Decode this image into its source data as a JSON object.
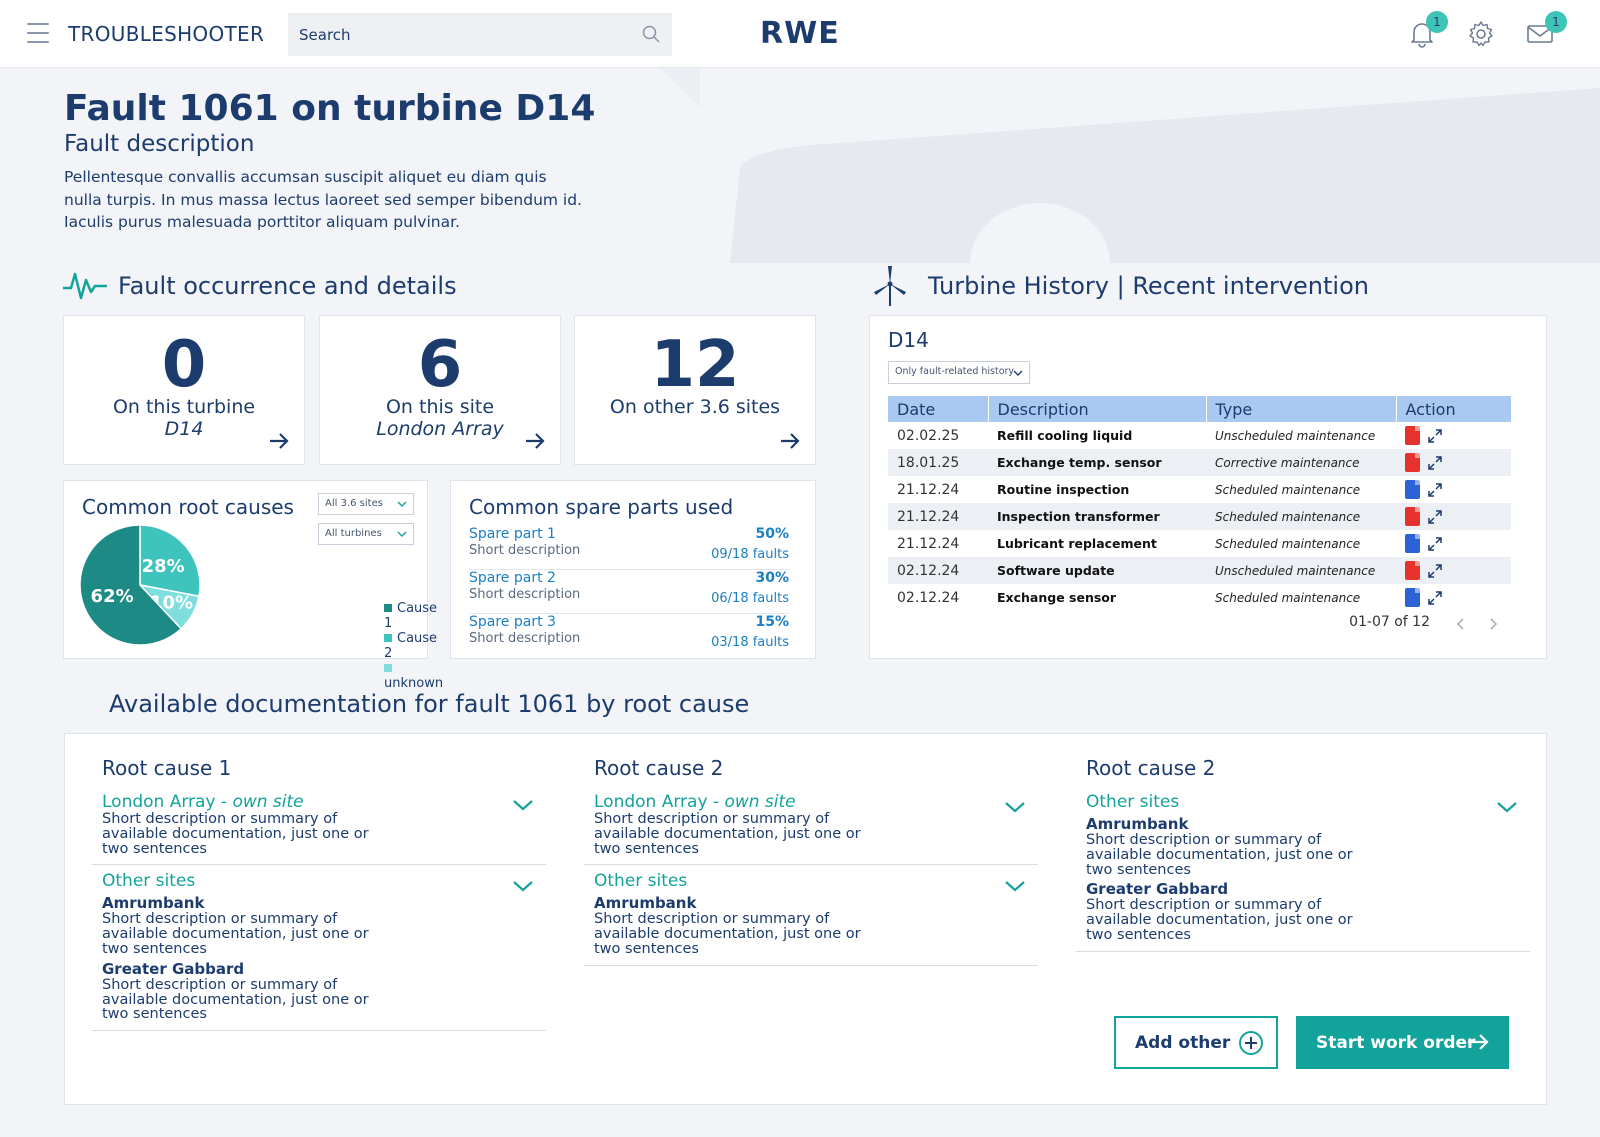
{
  "header": {
    "app_title": "TROUBLESHOOTER",
    "search_placeholder": "Search",
    "logo": "RWE",
    "notifications_count": "1",
    "messages_count": "1"
  },
  "hero": {
    "title": "Fault 1061 on turbine D14",
    "subtitle": "Fault description",
    "description": "Pellentesque convallis accumsan suscipit aliquet eu diam quis nulla turpis. In mus massa lectus laoreet sed semper bibendum id. Iaculis purus malesuada porttitor aliquam pulvinar."
  },
  "fault_section": {
    "title": "Fault occurrence and details",
    "kpis": [
      {
        "value": "0",
        "label": "On this turbine",
        "sub": "D14"
      },
      {
        "value": "6",
        "label": "On this site",
        "sub": "London Array"
      },
      {
        "value": "12",
        "label": "On other 3.6 sites",
        "sub": ""
      }
    ]
  },
  "root_causes": {
    "title": "Common root causes",
    "filter_sites": "All 3.6 sites",
    "filter_turbines": "All turbines",
    "legend": [
      "Cause 1",
      "Cause 2",
      "unknown"
    ],
    "colors": [
      "#1e8a86",
      "#3ec4bc",
      "#7fdedd"
    ]
  },
  "chart_data": {
    "type": "pie",
    "labels": [
      "Cause 1",
      "Cause 2",
      "unknown"
    ],
    "values": [
      62,
      28,
      10
    ],
    "data_labels": [
      "62%",
      "28%",
      "10%"
    ]
  },
  "spare_parts": {
    "title": "Common spare parts used",
    "items": [
      {
        "name": "Spare part 1",
        "desc": "Short description",
        "pct": "50%",
        "faults": "09/18 faults"
      },
      {
        "name": "Spare part 2",
        "desc": "Short description",
        "pct": "30%",
        "faults": "06/18 faults"
      },
      {
        "name": "Spare part 3",
        "desc": "Short description",
        "pct": "15%",
        "faults": "03/18 faults"
      }
    ]
  },
  "history": {
    "title": "Turbine History | Recent intervention",
    "turbine": "D14",
    "filter": "Only fault-related history",
    "columns": [
      "Date",
      "Description",
      "Type",
      "Action"
    ],
    "rows": [
      {
        "date": "02.02.25",
        "desc": "Refill cooling liquid",
        "type": "Unscheduled maintenance",
        "file": "pdf"
      },
      {
        "date": "18.01.25",
        "desc": "Exchange temp. sensor",
        "type": "Corrective maintenance",
        "file": "pdf"
      },
      {
        "date": "21.12.24",
        "desc": "Routine inspection",
        "type": "Scheduled maintenance",
        "file": "doc"
      },
      {
        "date": "21.12.24",
        "desc": "Inspection transformer",
        "type": "Scheduled maintenance",
        "file": "pdf"
      },
      {
        "date": "21.12.24",
        "desc": "Lubricant replacement",
        "type": "Scheduled maintenance",
        "file": "doc"
      },
      {
        "date": "02.12.24",
        "desc": "Software update",
        "type": "Unscheduled maintenance",
        "file": "pdf"
      },
      {
        "date": "02.12.24",
        "desc": "Exchange sensor",
        "type": "Scheduled maintenance",
        "file": "doc"
      }
    ],
    "pagination": "01-07 of 12"
  },
  "docs": {
    "title": "Available documentation for fault 1061 by root cause",
    "columns": [
      {
        "heading": "Root cause 1",
        "own_site": "London Array -",
        "own_site_tag": "own site",
        "own_text": "Short description or summary of available documentation, just one or two sentences",
        "other_label": "Other sites",
        "other_sites": [
          {
            "name": "Amrumbank",
            "text": "Short description or summary of available documentation, just one or two sentences"
          },
          {
            "name": "Greater Gabbard",
            "text": "Short description or summary of available documentation, just one or two sentences"
          }
        ]
      },
      {
        "heading": "Root cause 2",
        "own_site": "London Array -",
        "own_site_tag": "own site",
        "own_text": "Short description or summary of available documentation, just one or two sentences",
        "other_label": "Other sites",
        "other_sites": [
          {
            "name": "Amrumbank",
            "text": "Short description or summary of available documentation, just one or two sentences"
          }
        ]
      },
      {
        "heading": "Root cause 2",
        "other_label": "Other sites",
        "other_sites": [
          {
            "name": "Amrumbank",
            "text": "Short description or summary of available documentation, just one or two sentences"
          },
          {
            "name": "Greater Gabbard",
            "text": "Short description or summary of available documentation, just one or two sentences"
          }
        ]
      }
    ],
    "add_other": "Add other",
    "start_work_order": "Start work order"
  }
}
